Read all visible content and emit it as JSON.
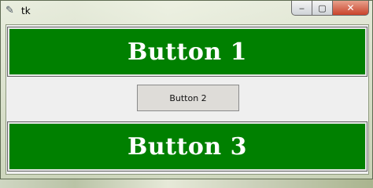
{
  "window": {
    "title": "tk",
    "app_icon": "feather-icon",
    "controls": {
      "minimize_glyph": "‒",
      "maximize_glyph": "▢",
      "close_glyph": "✕"
    }
  },
  "buttons": {
    "button1_label": "Button 1",
    "button2_label": "Button 2",
    "button3_label": "Button 3"
  },
  "colors": {
    "button_green": "#008000",
    "button_text": "#ffffff",
    "button2_bg": "#dedcd8",
    "close_red": "#c9432b"
  }
}
